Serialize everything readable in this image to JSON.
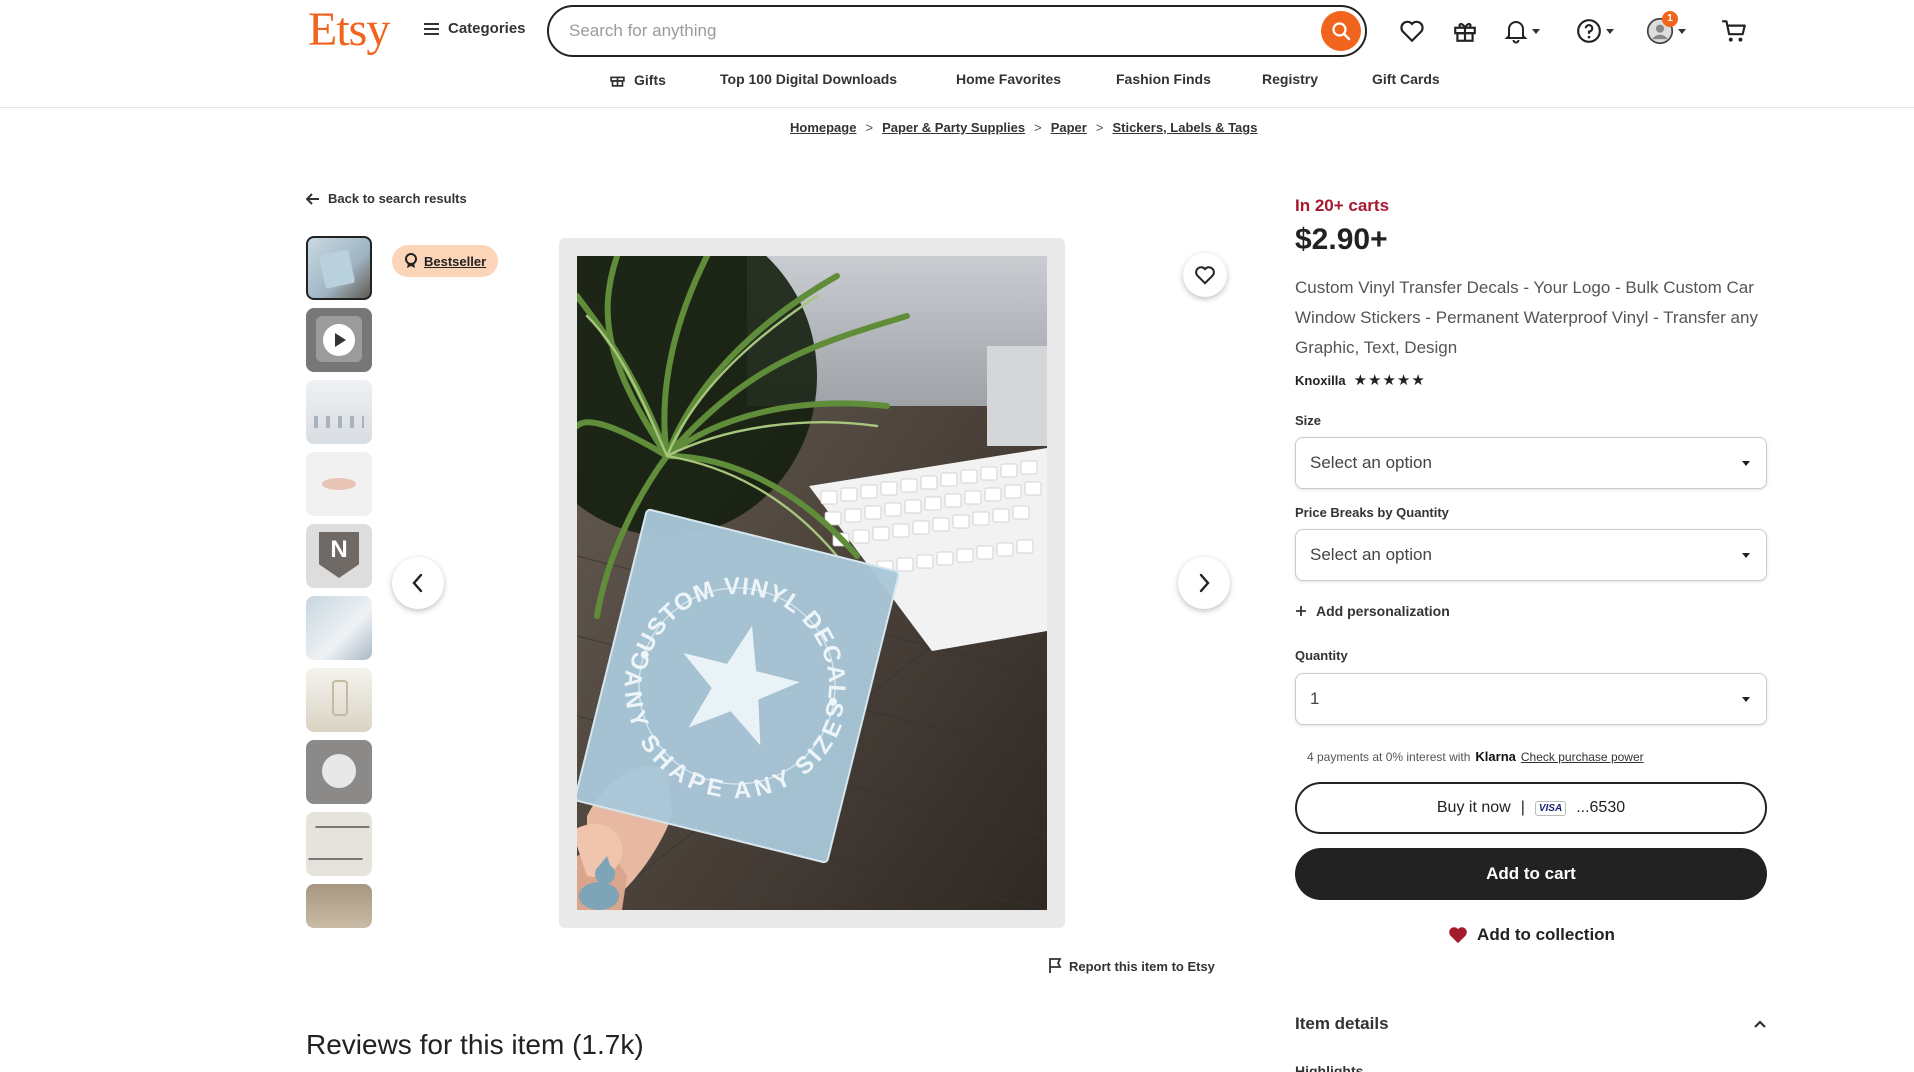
{
  "header": {
    "logo": "Etsy",
    "categories_label": "Categories",
    "search_placeholder": "Search for anything",
    "notification_count": "1"
  },
  "subnav": {
    "items": [
      "Gifts",
      "Top 100 Digital Downloads",
      "Home Favorites",
      "Fashion Finds",
      "Registry",
      "Gift Cards"
    ]
  },
  "breadcrumb": {
    "items": [
      "Homepage",
      "Paper & Party Supplies",
      "Paper",
      "Stickers, Labels & Tags"
    ],
    "separator": ">"
  },
  "gallery": {
    "back_link": "Back to search results",
    "bestseller_label": "Bestseller",
    "report_link": "Report this item to Etsy",
    "sticker_text_top": "CUSTOM VINYL DECALS",
    "sticker_text_bottom": "ANY SHAPE ANY SIZE",
    "thumb_letter": "N"
  },
  "product": {
    "in_carts": "In 20+ carts",
    "price": "$2.90+",
    "title": "Custom Vinyl Transfer Decals - Your Logo - Bulk Custom Car Window Stickers - Permanent Waterproof Vinyl - Transfer any Graphic, Text, Design",
    "seller": "Knoxilla",
    "stars": "★★★★★",
    "rating_out_of_5": 5
  },
  "options": {
    "size_label": "Size",
    "size_value": "Select an option",
    "price_breaks_label": "Price Breaks by Quantity",
    "price_breaks_value": "Select an option",
    "add_personalization": "Add personalization",
    "quantity_label": "Quantity",
    "quantity_value": "1"
  },
  "purchase": {
    "klarna_prefix": "4 payments at 0% interest with",
    "klarna_brand": "Klarna",
    "klarna_link": "Check purchase power",
    "buy_now": "Buy it now",
    "divider": "|",
    "card_brand": "VISA",
    "card_last4": "...6530",
    "add_to_cart": "Add to cart",
    "add_to_collection": "Add to collection"
  },
  "details": {
    "item_details": "Item details",
    "highlights": "Highlights"
  },
  "reviews": {
    "title": "Reviews for this item (1.7k)"
  },
  "colors": {
    "brand": "#f1641e",
    "in_carts": "#a61a2e",
    "primary_button": "#222222",
    "bestseller_bg": "#fcd5b8"
  }
}
